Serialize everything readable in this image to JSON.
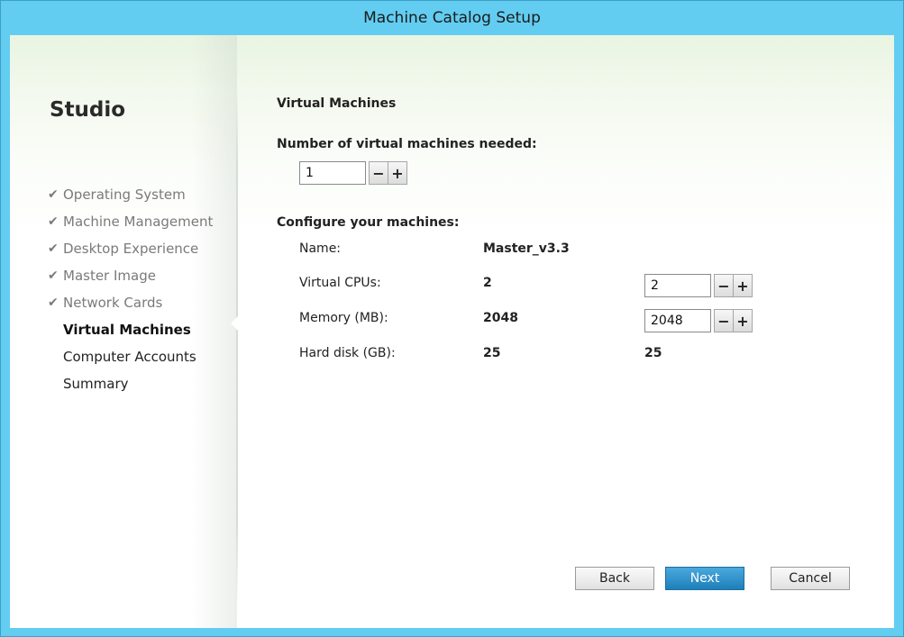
{
  "window": {
    "title": "Machine Catalog Setup"
  },
  "sidebar": {
    "app_title": "Studio",
    "check_glyph": "✔",
    "steps": [
      {
        "label": "Operating System",
        "state": "done"
      },
      {
        "label": "Machine Management",
        "state": "done"
      },
      {
        "label": "Desktop Experience",
        "state": "done"
      },
      {
        "label": "Master Image",
        "state": "done"
      },
      {
        "label": "Network Cards",
        "state": "done"
      },
      {
        "label": "Virtual Machines",
        "state": "current"
      },
      {
        "label": "Computer Accounts",
        "state": "pending"
      },
      {
        "label": "Summary",
        "state": "pending"
      }
    ]
  },
  "main": {
    "section_title": "Virtual Machines",
    "vm_count": {
      "label": "Number of virtual machines needed:",
      "value": "1"
    },
    "configure_title": "Configure your machines:",
    "name": {
      "label": "Name:",
      "value": "Master_v3.3"
    },
    "cpus": {
      "label": "Virtual CPUs:",
      "value": "2",
      "input": "2"
    },
    "memory": {
      "label": "Memory (MB):",
      "value": "2048",
      "input": "2048"
    },
    "disk": {
      "label": "Hard disk (GB):",
      "value": "25",
      "value2": "25"
    },
    "minus": "−",
    "plus": "+"
  },
  "footer": {
    "back": "Back",
    "next": "Next",
    "cancel": "Cancel"
  },
  "colors": {
    "titlebar": "#62cdf1",
    "primary_button": "#2a8cc6"
  }
}
